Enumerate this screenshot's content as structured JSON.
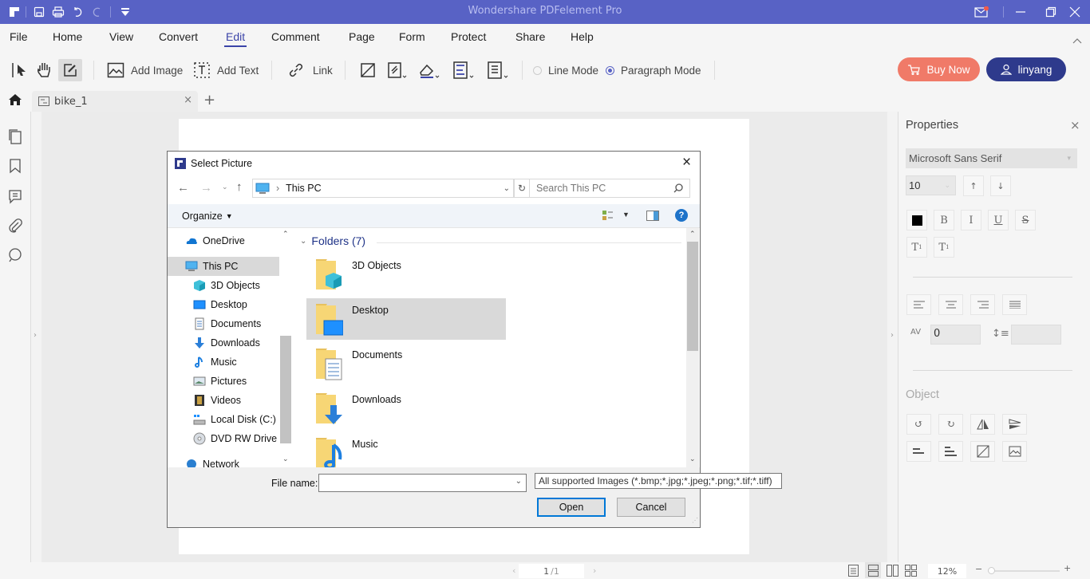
{
  "app": {
    "title": "Wondershare PDFelement Pro"
  },
  "menu": {
    "items": [
      "File",
      "Home",
      "View",
      "Convert",
      "Edit",
      "Comment",
      "Page",
      "Form",
      "Protect",
      "Share",
      "Help"
    ],
    "active": "Edit"
  },
  "toolbar": {
    "add_image": "Add Image",
    "add_text": "Add Text",
    "link": "Link",
    "line_mode": "Line Mode",
    "paragraph_mode": "Paragraph Mode",
    "selected_mode": "Paragraph Mode",
    "buy_now": "Buy Now",
    "user": "linyang"
  },
  "colors": {
    "titlebar": "#5862c5",
    "buy_now": "#f07a68",
    "user_button": "#2e3a8c",
    "accent": "#3b44a8"
  },
  "tabs": {
    "document": "bike_1"
  },
  "properties": {
    "title": "Properties",
    "font": "Microsoft Sans Serif",
    "font_size": "10",
    "char_spacing": "0",
    "line_spacing": "",
    "object_label": "Object"
  },
  "status": {
    "page_current": "1",
    "page_total": "/1",
    "zoom": "12%"
  },
  "dialog": {
    "title": "Select Picture",
    "address": "This PC",
    "search_placeholder": "Search This PC",
    "organize": "Organize",
    "nav": [
      "OneDrive",
      "This PC",
      "3D Objects",
      "Desktop",
      "Documents",
      "Downloads",
      "Music",
      "Pictures",
      "Videos",
      "Local Disk (C:)",
      "DVD RW Drive (D",
      "Network"
    ],
    "nav_selected": "This PC",
    "group_header": "Folders (7)",
    "folders": [
      "3D Objects",
      "Desktop",
      "Documents",
      "Downloads",
      "Music"
    ],
    "folder_selected": "Desktop",
    "file_name_label": "File name:",
    "file_name_value": "",
    "file_type": "All supported Images (*.bmp;*.jpg;*.jpeg;*.png;*.tif;*.tiff)",
    "open": "Open",
    "cancel": "Cancel"
  }
}
